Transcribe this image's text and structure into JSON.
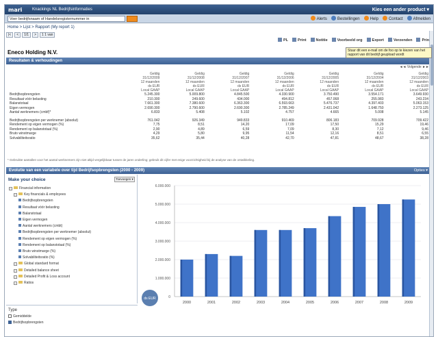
{
  "app": {
    "logo": "mari",
    "title": "Knackings NL Bedrijfsinformaties",
    "choose_product": "Kies een ander product ▾"
  },
  "search": {
    "value": "Voer bedrijfsnaam of Handelsregisternummer in"
  },
  "toplinks": [
    {
      "label": "Alerts",
      "color": "#f08b1d"
    },
    {
      "label": "Bestellingen",
      "color": "#4f7fbf"
    },
    {
      "label": "Help",
      "color": "#f08b1d"
    },
    {
      "label": "Contact",
      "color": "#f08b1d"
    },
    {
      "label": "Afmelden",
      "color": "#4f7fbf"
    }
  ],
  "breadcrumb": "Home > Lijst > Rapport (My report 1)",
  "pager": [
    "|<",
    "<",
    "1/1",
    ">",
    "1 1 van"
  ],
  "actions": [
    "PL",
    "Print",
    "Notitie",
    "Voorbeeld org",
    "Export",
    "Verzenden",
    "Print"
  ],
  "tooltip": "Stuur dit een e-mail om de foo op te kiezen van het rapport van dit bedrijf geupload wordt",
  "company": "Eneco Holding N.V.",
  "results": {
    "header": "Resultaten & verhoudingen",
    "nav": "◄◄ Volgende ►►",
    "columns": [
      "Geldig\n31/12/2009\n12 maanden\nds EUR\nLocal GAAP",
      "Geldig\n31/12/2008\n12 maanden\nds EUR\nLocal GAAP",
      "Geldig\n31/12/2007\n12 maanden\nds EUR\nLocal GAAP",
      "Geldig\n31/12/2006\n12 maanden\nds EUR\nLocal GAAP",
      "Geldig\n31/12/2005\n12 maanden\nds EUR\nLocal GAAP",
      "Geldig\n31/12/2004\n12 maanden\nds EUR\nLocal GAAP",
      "Geldig\n31/12/2003\n12 maanden\nds EUR\nLocal GAAP"
    ],
    "rows": [
      {
        "label": "Bedrijfsopbrengsten",
        "values": [
          "5.245.300",
          "5.009.800",
          "4.845.500",
          "4.330.900",
          "3.750.490",
          "3.554.171",
          "3.649.930"
        ]
      },
      {
        "label": "Resultaat vóór belasting",
        "values": [
          "210.300",
          "249.600",
          "434.000",
          "494.812",
          "457.068",
          "255.983",
          "243.234"
        ]
      },
      {
        "label": "Balanstotaal",
        "values": [
          "7.661.300",
          "7.380.600",
          "6.363.300",
          "6.593.663",
          "5.476.737",
          "4.397.403",
          "5.063.153"
        ]
      },
      {
        "label": "Eigen vermogen",
        "values": [
          "2.690.300",
          "2.790.600",
          "2.690.300",
          "2.785.249",
          "2.431.042",
          "1.648.750",
          "2.273.125"
        ]
      },
      {
        "label": "Aantal werknemers (cmbf)*",
        "values": [
          "6.833",
          "5.408",
          "5.102",
          "4.757",
          "4.665",
          "5.008",
          "5.145"
        ]
      }
    ],
    "ratio_rows": [
      {
        "label": "Bedrijfsopbrengsten per werknemer (absolut)",
        "values": [
          "761.042",
          "926.349",
          "949.833",
          "910.469",
          "806.183",
          "709.928",
          "709.422"
        ]
      },
      {
        "label": "Rendement op eigen vermogen (%)",
        "values": [
          "7,75",
          "8,51",
          "14,20",
          "17,09",
          "17,50",
          "15,29",
          "19,46"
        ]
      },
      {
        "label": "Rendement op balanstotaal (%)",
        "values": [
          "2,90",
          "4,89",
          "6,59",
          "7,09",
          "8,30",
          "7,12",
          "9,46"
        ]
      },
      {
        "label": "Bruto winstmarge",
        "values": [
          "4,29",
          "5,80",
          "9,95",
          "11,54",
          "12,16",
          "8,51",
          "6,55"
        ]
      },
      {
        "label": "Solvabiliteitsratio",
        "values": [
          "35,62",
          "35,44",
          "40,28",
          "42,70",
          "47,81",
          "48,67",
          "38,28"
        ]
      }
    ],
    "footnote": "* Gebruikte aantallen voor het aantal werknemers zijn niet altijd vergelijkbaar tussen de jaren onderling; gebruik dit cijfer met enige voorzichtigheid bij de analyse van de ontwikkeling."
  },
  "chart_panel": {
    "header": "Evolutie van een variabele over tijd Bedrijfsopbrengsten (2000 - 2009)",
    "options": "Opties ▾",
    "left_title": "Make your choice",
    "left_button": "Toevoegen ▾",
    "tree": [
      {
        "level": 0,
        "kind": "folder",
        "label": "Financial information"
      },
      {
        "level": 1,
        "kind": "folder",
        "label": "Key financials & employees"
      },
      {
        "level": 2,
        "kind": "item",
        "label": "Bedrijfsopbrengsten"
      },
      {
        "level": 2,
        "kind": "item",
        "label": "Resultaat vóór belasting"
      },
      {
        "level": 2,
        "kind": "item",
        "label": "Balanstotaal"
      },
      {
        "level": 2,
        "kind": "item",
        "label": "Eigen vermogen"
      },
      {
        "level": 2,
        "kind": "item",
        "label": "Aantal werknemers (cmbt)"
      },
      {
        "level": 2,
        "kind": "item",
        "label": "Bedrijfsopbrengsten per werknemer (absolut)"
      },
      {
        "level": 2,
        "kind": "item",
        "label": "Rendement op eigen vermogen (%)"
      },
      {
        "level": 2,
        "kind": "item",
        "label": "Rendement op balanstotaal (%)"
      },
      {
        "level": 2,
        "kind": "item",
        "label": "Bruto winstmarge (%)"
      },
      {
        "level": 2,
        "kind": "item",
        "label": "Solvabiliteitsratio (%)"
      },
      {
        "level": 1,
        "kind": "folder",
        "label": "Global standard format"
      },
      {
        "level": 1,
        "kind": "folder",
        "label": "Detailed balance sheet"
      },
      {
        "level": 1,
        "kind": "folder",
        "label": "Detailed Profit & Loss account"
      },
      {
        "level": 1,
        "kind": "folder",
        "label": "Ratios"
      }
    ],
    "bottom_label": "Type",
    "bottom_option1": "Gemiddelde",
    "bottom_option2": "Bedrijfsopbrengsten",
    "unit_badge": "ds EUR"
  },
  "colors": {
    "bar": "#3f73c8",
    "bar_dark": "#2a55a0",
    "header": "#3e6294"
  },
  "chart_data": {
    "type": "bar",
    "title": "",
    "xlabel": "",
    "ylabel": "",
    "categories": [
      "2000",
      "2001",
      "2002",
      "2003",
      "2004",
      "2005",
      "2006",
      "2007",
      "2008",
      "2009"
    ],
    "values": [
      2000000,
      2300000,
      2200000,
      3600000,
      3600000,
      3700000,
      4350000,
      4850000,
      5000000,
      5250000
    ],
    "ylim": [
      0,
      6000000
    ],
    "y_ticks": [
      "0",
      "1.000.000",
      "2.000.000",
      "3.000.000",
      "4.000.000",
      "5.000.000",
      "6.000.000"
    ],
    "grid": true
  }
}
